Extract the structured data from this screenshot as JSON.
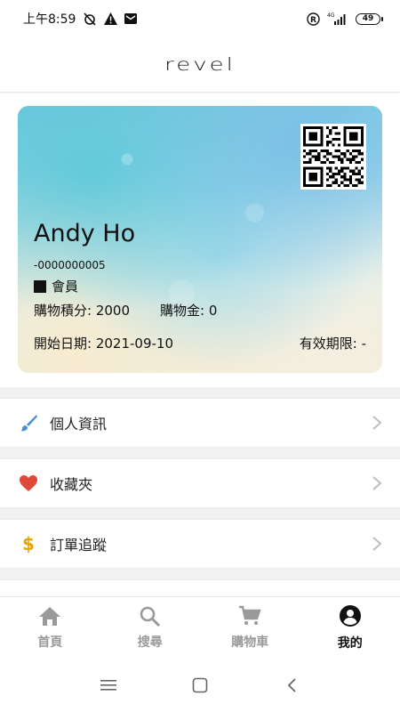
{
  "status_bar": {
    "time": "上午8:59",
    "network": "4G",
    "battery": "49"
  },
  "header": {
    "logo": "revel"
  },
  "card": {
    "name": "Andy Ho",
    "member_id": "-0000000005",
    "level": "會員",
    "points": "購物積分: 2000",
    "credit": "購物金: 0",
    "start_date": "開始日期: 2021-09-10",
    "expiry": "有效期限: -"
  },
  "menu": {
    "items": [
      {
        "label": "個人資訊",
        "icon": "brush-icon"
      },
      {
        "label": "收藏夾",
        "icon": "heart-icon"
      },
      {
        "label": "訂單追蹤",
        "icon": "dollar-icon"
      }
    ]
  },
  "tabs": [
    {
      "label": "首頁",
      "icon": "home-icon"
    },
    {
      "label": "搜尋",
      "icon": "search-icon"
    },
    {
      "label": "購物車",
      "icon": "cart-icon"
    },
    {
      "label": "我的",
      "icon": "account-circle-icon",
      "active": true
    }
  ],
  "colors": {
    "accent_brush": "#4a8fd0",
    "heart": "#e0493a",
    "dollar": "#e9a400",
    "active_tab": "#111111",
    "inactive_tab": "#9a9a9a"
  }
}
